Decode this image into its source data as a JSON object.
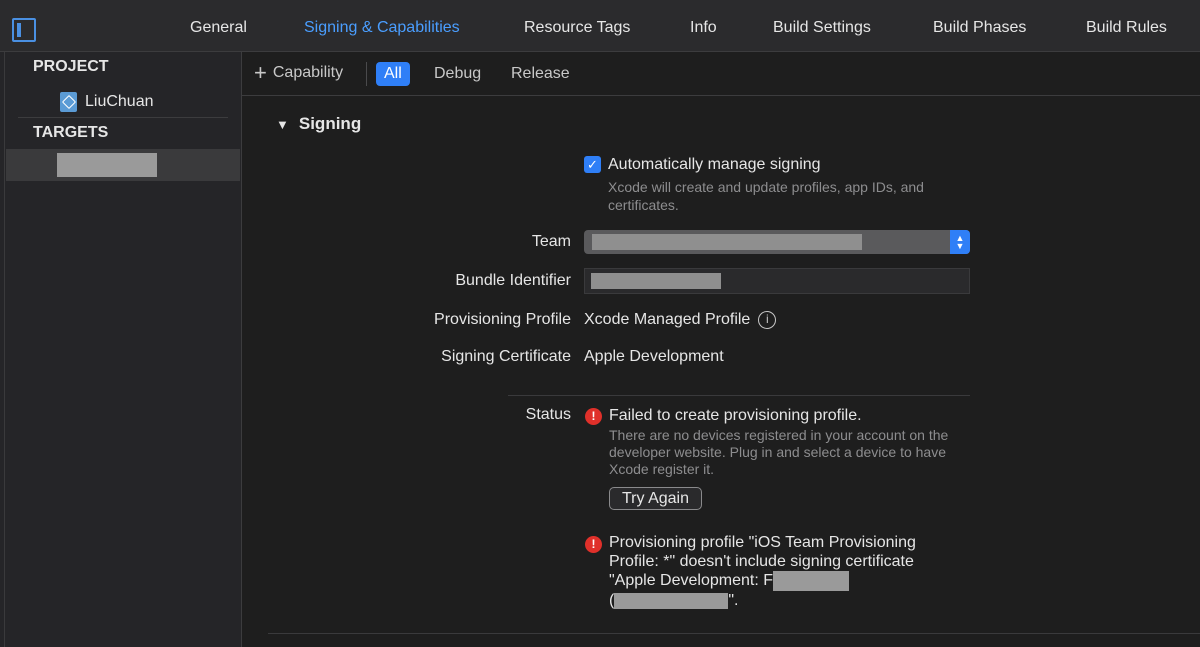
{
  "tabs": [
    {
      "label": "General",
      "active": false
    },
    {
      "label": "Signing & Capabilities",
      "active": true
    },
    {
      "label": "Resource Tags",
      "active": false
    },
    {
      "label": "Info",
      "active": false
    },
    {
      "label": "Build Settings",
      "active": false
    },
    {
      "label": "Build Phases",
      "active": false
    },
    {
      "label": "Build Rules",
      "active": false
    }
  ],
  "navigator": {
    "project_heading": "PROJECT",
    "project_name": "LiuChuan",
    "targets_heading": "TARGETS"
  },
  "toolbar": {
    "capability_label": "Capability",
    "filters": [
      "All",
      "Debug",
      "Release"
    ],
    "active_filter": "All"
  },
  "signing": {
    "section_title": "Signing",
    "auto_manage_label": "Automatically manage signing",
    "auto_manage_checked": true,
    "auto_manage_hint": "Xcode will create and update profiles, app IDs, and certificates.",
    "team_label": "Team",
    "bundle_label": "Bundle Identifier",
    "profile_label": "Provisioning Profile",
    "profile_value": "Xcode Managed Profile",
    "cert_label": "Signing Certificate",
    "cert_value": "Apple Development",
    "status_label": "Status",
    "error1_title": "Failed to create provisioning profile.",
    "error1_detail": "There are no devices registered in your account on the developer website. Plug in and select a device to have Xcode register it.",
    "try_again_label": "Try Again",
    "error2_line1": "Provisioning profile \"iOS Team Provisioning",
    "error2_line2": "Profile: *\" doesn't include signing certificate",
    "error2_line3": "\"Apple Development: F",
    "error2_line4_start": "(",
    "error2_line4_end": "\"."
  },
  "colors": {
    "accent": "#2f7ff7",
    "active_tab": "#4a9eff",
    "error": "#e0302a",
    "background": "#1e1e1e"
  }
}
